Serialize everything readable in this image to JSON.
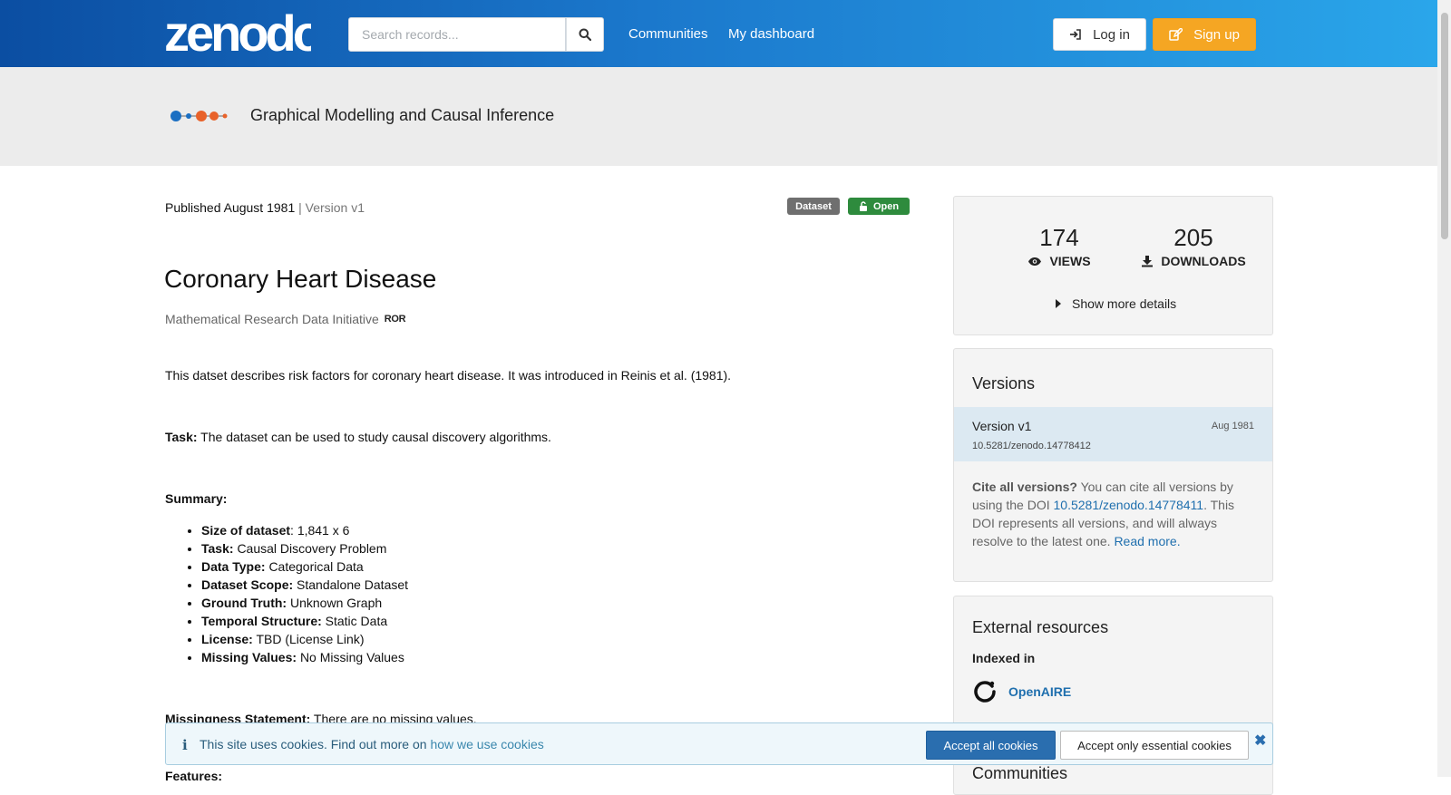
{
  "header": {
    "logo_text": "zenodo",
    "search_placeholder": "Search records...",
    "nav": [
      "Communities",
      "My dashboard"
    ],
    "login_label": "Log in",
    "signup_label": "Sign up"
  },
  "community": {
    "title": "Graphical Modelling and Causal Inference"
  },
  "record": {
    "published": "Published August 1981",
    "version_sep": " | Version v1",
    "badge_type": "Dataset",
    "badge_access": "Open",
    "title": "Coronary Heart Disease",
    "creator": "Mathematical Research Data Initiative",
    "ror_label": "ROR",
    "description": "This datset describes risk factors for coronary heart disease. It was introduced in Reinis et al. (1981).",
    "task_label": "Task:",
    "task_text": " The dataset can be used to study causal discovery algorithms.",
    "summary_heading": "Summary:",
    "summary": [
      {
        "label": "Size of dataset",
        "sep": ": ",
        "value": "1,841 x 6"
      },
      {
        "label": "Task:",
        "sep": " ",
        "value": "Causal Discovery Problem"
      },
      {
        "label": "Data Type:",
        "sep": " ",
        "value": "Categorical Data"
      },
      {
        "label": "Dataset Scope:",
        "sep": " ",
        "value": "Standalone Dataset"
      },
      {
        "label": "Ground Truth:",
        "sep": " ",
        "value": "Unknown Graph"
      },
      {
        "label": "Temporal Structure:",
        "sep": " ",
        "value": "Static Data"
      },
      {
        "label": "License:",
        "sep": " ",
        "value": "TBD (License Link)"
      },
      {
        "label": "Missing Values:",
        "sep": " ",
        "value": "No Missing Values"
      }
    ],
    "missingness_label": "Missingness Statement:",
    "missingness_text": " There are no missing values.",
    "features_label": "Features:"
  },
  "stats": {
    "views": "174",
    "views_label": "VIEWS",
    "downloads": "205",
    "downloads_label": "DOWNLOADS",
    "more_details": "Show more details"
  },
  "versions": {
    "heading": "Versions",
    "current": {
      "name": "Version v1",
      "date": "Aug 1981",
      "doi": "10.5281/zenodo.14778412"
    },
    "cite_bold": "Cite all versions?",
    "cite_text1": " You can cite all versions by using the DOI ",
    "cite_doi": "10.5281/zenodo.14778411",
    "cite_text2": ". This DOI represents all versions, and will always resolve to the latest one. ",
    "read_more": "Read more."
  },
  "external": {
    "heading": "External resources",
    "indexed_in": "Indexed in",
    "openaire": "OpenAIRE",
    "communities_heading": "Communities"
  },
  "cookie": {
    "icon": "i",
    "text": "This site uses cookies. Find out more on ",
    "link": "how we use cookies",
    "accept_all": "Accept all cookies",
    "accept_essential": "Accept only essential cookies",
    "close": "✖"
  }
}
